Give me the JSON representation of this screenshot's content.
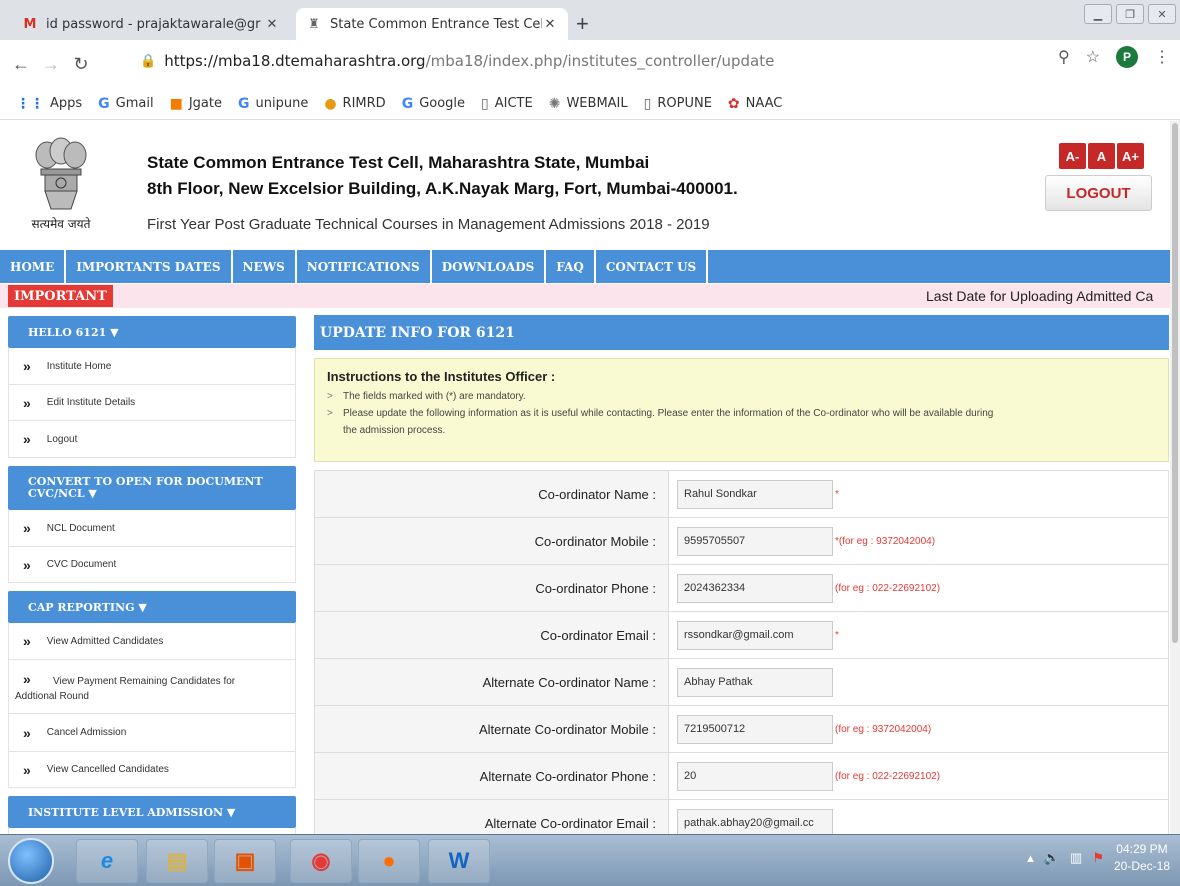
{
  "browser": {
    "tabs": [
      {
        "title": "id password - prajaktawarale@gr",
        "favicon": "M",
        "favicon_color": "#d93025",
        "active": false
      },
      {
        "title": "State Common Entrance Test Cel",
        "favicon": "emblem",
        "active": true
      }
    ],
    "url_host": "https://mba18.dtemaharashtra.org",
    "url_path": "/mba18/index.php/institutes_controller/update",
    "profile_initial": "P",
    "bookmarks": [
      {
        "label": "Apps",
        "icon": "apps-grid-icon"
      },
      {
        "label": "Gmail",
        "icon": "google-icon"
      },
      {
        "label": "Jgate",
        "icon": "orange-square-icon"
      },
      {
        "label": "unipune",
        "icon": "google-icon"
      },
      {
        "label": "RIMRD",
        "icon": "rimrd-icon"
      },
      {
        "label": "Google",
        "icon": "google-icon"
      },
      {
        "label": "AICTE",
        "icon": "page-icon"
      },
      {
        "label": "WEBMAIL",
        "icon": "webmail-icon"
      },
      {
        "label": "ROPUNE",
        "icon": "page-icon"
      },
      {
        "label": "NAAC",
        "icon": "naac-icon"
      }
    ]
  },
  "header": {
    "motto": "सत्यमेव जयते",
    "line1": "State Common Entrance Test Cell, Maharashtra State, Mumbai",
    "line2": "8th Floor, New Excelsior Building, A.K.Nayak Marg, Fort, Mumbai-400001.",
    "line3": "First Year Post Graduate Technical Courses in Management Admissions 2018 - 2019",
    "font_buttons": [
      "A-",
      "A",
      "A+"
    ],
    "logout": "LOGOUT"
  },
  "nav": [
    "HOME",
    "IMPORTANTS DATES",
    "NEWS",
    "NOTIFICATIONS",
    "DOWNLOADS",
    "FAQ",
    "CONTACT US"
  ],
  "ticker": {
    "label": "IMPORTANT",
    "message": "Last Date for Uploading Admitted Ca"
  },
  "sidebar": {
    "sections": [
      {
        "title": "HELLO 6121 ▼",
        "items": [
          "Institute Home",
          "Edit Institute Details",
          "Logout"
        ]
      },
      {
        "title_line1": "CONVERT TO OPEN FOR DOCUMENT",
        "title_line2": "CVC/NCL ▼",
        "items": [
          "NCL Document",
          "CVC Document"
        ]
      },
      {
        "title": "CAP REPORTING ▼",
        "items": [
          "View Admitted Candidates",
          "View Payment Remaining Candidates for",
          "Addtional Round",
          "Cancel Admission",
          "View Cancelled Candidates"
        ]
      },
      {
        "title": "INSTITUTE LEVEL ADMISSION ▼"
      }
    ]
  },
  "content": {
    "title": "UPDATE INFO FOR 6121",
    "instructions_title": "Instructions to the Institutes Officer :",
    "instructions": [
      "The fields marked with (*) are mandatory.",
      "Please update the following information as it is useful while contacting. Please enter the information of the Co-ordinator who will be available during",
      "the admission process."
    ],
    "fields": [
      {
        "label": "Co-ordinator Name :",
        "value": "Rahul Sondkar",
        "hint": "*"
      },
      {
        "label": "Co-ordinator Mobile :",
        "value": "9595705507",
        "hint": "*(for eg : 9372042004)"
      },
      {
        "label": "Co-ordinator Phone :",
        "value": "2024362334",
        "hint": "(for eg : 022-22692102)"
      },
      {
        "label": "Co-ordinator Email :",
        "value": "rssondkar@gmail.com",
        "hint": "*"
      },
      {
        "label": "Alternate Co-ordinator Name :",
        "value": "Abhay Pathak",
        "hint": ""
      },
      {
        "label": "Alternate Co-ordinator Mobile :",
        "value": "7219500712",
        "hint": "(for eg : 9372042004)"
      },
      {
        "label": "Alternate Co-ordinator Phone :",
        "value": "20",
        "hint": "(for eg : 022-22692102)"
      },
      {
        "label": "Alternate Co-ordinator Email :",
        "value": "pathak.abhay20@gmail.cc",
        "hint": ""
      }
    ]
  },
  "taskbar": {
    "time": "04:29 PM",
    "date": "20-Dec-18"
  },
  "colors": {
    "nav_blue": "#4a90d9",
    "accent_red": "#c62828",
    "hint_red": "#e53935",
    "instr_bg": "#fafad2"
  }
}
